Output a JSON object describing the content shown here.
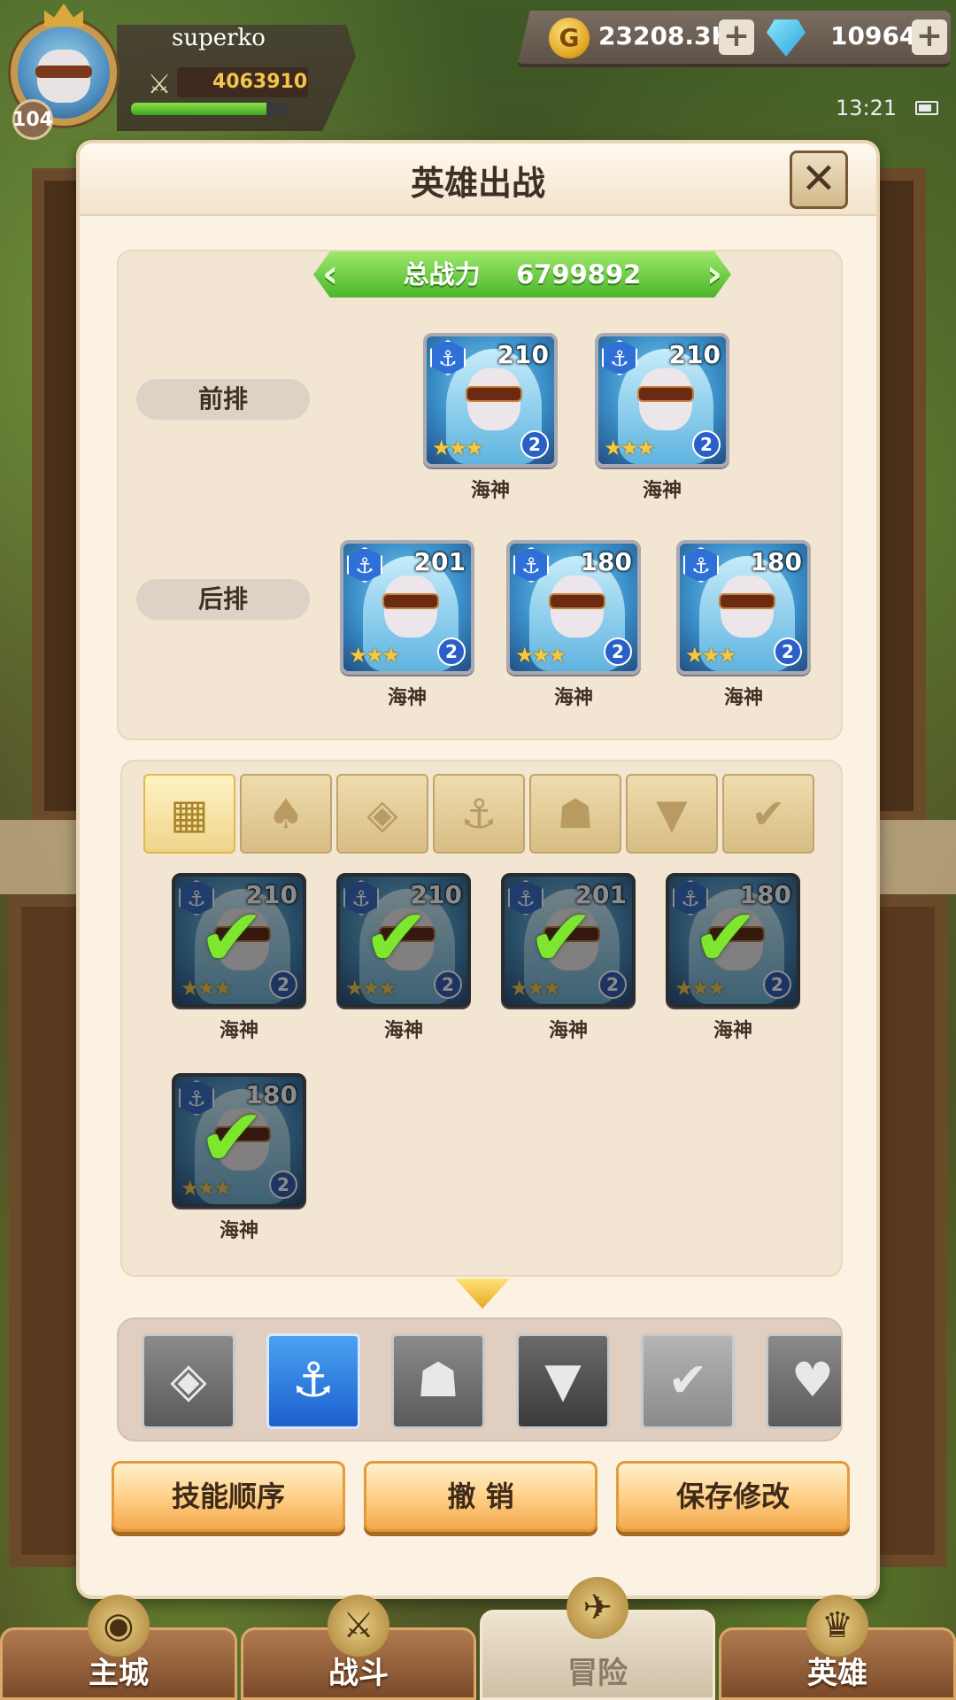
{
  "player": {
    "name": "superko",
    "level": "104",
    "power": "4063910",
    "xp_fraction": 0.85
  },
  "currency": {
    "gold": "23208.3K",
    "gems": "10964",
    "coin_glyph": "G"
  },
  "status": {
    "time": "13:21"
  },
  "modal": {
    "title": "英雄出战",
    "total_power_label": "总战力",
    "total_power": "6799892",
    "front_row_label": "前排",
    "back_row_label": "后排"
  },
  "front_row": [
    {
      "name": "海神",
      "level": "210",
      "star_count": "2"
    },
    {
      "name": "海神",
      "level": "210",
      "star_count": "2"
    }
  ],
  "back_row": [
    {
      "name": "海神",
      "level": "201",
      "star_count": "2"
    },
    {
      "name": "海神",
      "level": "180",
      "star_count": "2"
    },
    {
      "name": "海神",
      "level": "180",
      "star_count": "2"
    }
  ],
  "filter_tabs": [
    "all-icon",
    "nature-icon",
    "diamond-icon",
    "anchor-icon",
    "beast-icon",
    "demon-icon",
    "wing-icon"
  ],
  "roster": [
    {
      "name": "海神",
      "level": "210",
      "star_count": "2"
    },
    {
      "name": "海神",
      "level": "210",
      "star_count": "2"
    },
    {
      "name": "海神",
      "level": "201",
      "star_count": "2"
    },
    {
      "name": "海神",
      "level": "180",
      "star_count": "2"
    },
    {
      "name": "海神",
      "level": "180",
      "star_count": "2"
    }
  ],
  "element_buttons": [
    "diamond-icon",
    "anchor-icon",
    "beast-icon",
    "demon-icon",
    "wing-icon",
    "heart-icon"
  ],
  "actions": {
    "skill_order": "技能顺序",
    "undo": "撤 销",
    "save": "保存修改"
  },
  "nav": {
    "main_city": "主城",
    "battle": "战斗",
    "adventure": "冒险",
    "heroes": "英雄"
  },
  "colors": {
    "accent_green": "#4bb52b",
    "active_element_blue": "#1c5fd0",
    "button_orange": "#f3a94c"
  }
}
